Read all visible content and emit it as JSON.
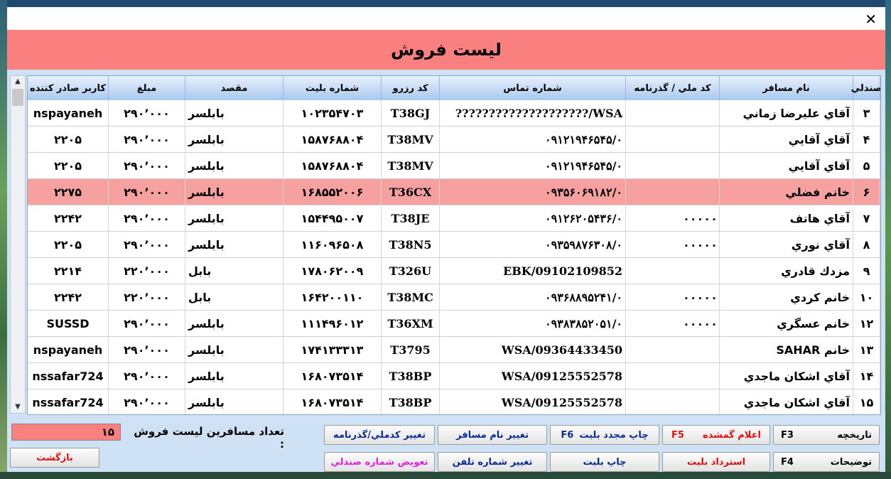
{
  "window": {
    "close": "✕"
  },
  "title": "ليست فروش",
  "columns": {
    "seat": "صندلي",
    "name": "نام مسافر",
    "national_id": "کد ملي / گذرنامه",
    "phone": "شماره تماس",
    "reservation": "کد رزرو",
    "ticket": "شماره بليت",
    "destination": "مقصد",
    "amount": "مبلغ",
    "issuer": "کاربر صادر کننده"
  },
  "rows": [
    {
      "seat": "۳",
      "name": "آقاي عليرضا زماني",
      "national_id": "",
      "phone": "????????????????????/WSA",
      "reservation": "T38GJ",
      "ticket": "۱۰۲۳۵۴۷۰۳",
      "destination": "بابلسر",
      "amount": "۲۹۰٬۰۰۰",
      "issuer": "nspayaneh",
      "selected": false
    },
    {
      "seat": "۴",
      "name": "آقاي آقايي",
      "national_id": "",
      "phone": "۰۹۱۲۱۹۴۶۵۴۵/۰",
      "reservation": "T38MV",
      "ticket": "۱۵۸۷۶۸۸۰۴",
      "destination": "بابلسر",
      "amount": "۲۹۰٬۰۰۰",
      "issuer": "۲۲۰۵",
      "selected": false
    },
    {
      "seat": "۵",
      "name": "آقاي آقايي",
      "national_id": "",
      "phone": "۰۹۱۲۱۹۴۶۵۴۵/۰",
      "reservation": "T38MV",
      "ticket": "۱۵۸۷۶۸۸۰۴",
      "destination": "بابلسر",
      "amount": "۲۹۰٬۰۰۰",
      "issuer": "۲۲۰۵",
      "selected": false
    },
    {
      "seat": "۶",
      "name": "خانم فضلي",
      "national_id": "",
      "phone": "۰۹۳۵۶۰۶۹۱۸۲/۰",
      "reservation": "T36CX",
      "ticket": "۱۶۸۵۵۲۰۰۶",
      "destination": "بابلسر",
      "amount": "۲۹۰٬۰۰۰",
      "issuer": "۲۲۷۵",
      "selected": true
    },
    {
      "seat": "۷",
      "name": "آقاي هاتف",
      "national_id": "۰۰۰۰۰",
      "phone": "۰۹۱۲۶۲۰۵۴۳۶/۰",
      "reservation": "T38JE",
      "ticket": "۱۵۴۴۹۵۰۰۷",
      "destination": "بابلسر",
      "amount": "۲۹۰٬۰۰۰",
      "issuer": "۲۲۴۲",
      "selected": false
    },
    {
      "seat": "۸",
      "name": "آقاي نوري",
      "national_id": "۰۰۰۰۰",
      "phone": "۰۹۳۵۹۸۷۶۳۰۸/۰",
      "reservation": "T38N5",
      "ticket": "۱۱۶۰۹۶۵۰۸",
      "destination": "بابلسر",
      "amount": "۲۹۰٬۰۰۰",
      "issuer": "۲۲۰۵",
      "selected": false
    },
    {
      "seat": "۹",
      "name": "مزدك قادري",
      "national_id": "",
      "phone": "EBK/09102109852",
      "reservation": "T326U",
      "ticket": "۱۷۸۰۶۲۰۰۹",
      "destination": "بابل",
      "amount": "۲۲۰٬۰۰۰",
      "issuer": "۲۲۱۴",
      "selected": false
    },
    {
      "seat": "۱۰",
      "name": "خانم کردي",
      "national_id": "۰۰۰۰۰",
      "phone": "۰۹۳۶۸۸۹۵۲۴۱/۰",
      "reservation": "T38MC",
      "ticket": "۱۶۴۲۰۰۱۱۰",
      "destination": "بابل",
      "amount": "۲۲۰٬۰۰۰",
      "issuer": "۲۲۴۲",
      "selected": false
    },
    {
      "seat": "۱۲",
      "name": "خانم عسگري",
      "national_id": "۰۰۰۰۰",
      "phone": "۰۹۳۸۳۸۵۲۰۵۱/۰",
      "reservation": "T36XM",
      "ticket": "۱۱۱۴۹۶۰۱۲",
      "destination": "بابلسر",
      "amount": "۲۹۰٬۰۰۰",
      "issuer": "SUSSD",
      "selected": false
    },
    {
      "seat": "۱۳",
      "name": "خانم SAHAR",
      "national_id": "",
      "phone": "WSA/09364433450",
      "reservation": "T3795",
      "ticket": "۱۷۴۱۳۳۳۱۳",
      "destination": "بابلسر",
      "amount": "۲۹۰٬۰۰۰",
      "issuer": "nspayaneh",
      "selected": false
    },
    {
      "seat": "۱۴",
      "name": "آقاي اشكان ماجدي",
      "national_id": "",
      "phone": "WSA/09125552578",
      "reservation": "T38BP",
      "ticket": "۱۶۸۰۷۳۵۱۴",
      "destination": "بابلسر",
      "amount": "۲۹۰٬۰۰۰",
      "issuer": "nssafar724",
      "selected": false
    },
    {
      "seat": "۱۵",
      "name": "آقاي اشكان ماجدي",
      "national_id": "",
      "phone": "WSA/09125552578",
      "reservation": "T38BP",
      "ticket": "۱۶۸۰۷۳۵۱۴",
      "destination": "بابلسر",
      "amount": "۲۹۰٬۰۰۰",
      "issuer": "nssafar724",
      "selected": false
    }
  ],
  "footer": {
    "count_label": "تعداد مسافرين ليست فروش :",
    "count_value": "۱۵",
    "back": "بازگشت",
    "history": "تاريخچه",
    "history_key": "F3",
    "lost": "اعلام گمشده",
    "lost_key": "F5",
    "reprint": "چاپ مجدد بليت",
    "reprint_key": "F6",
    "change_name": "تغيير نام مسافر",
    "change_nid": "تغيير کدملي/گذرنامه",
    "notes": "توضيحات",
    "notes_key": "F4",
    "refund": "استرداد بليت",
    "print": "چاپ بليت",
    "change_phone": "تغيير شماره تلفن",
    "swap_seat": "تعويض شماره صندلي"
  }
}
